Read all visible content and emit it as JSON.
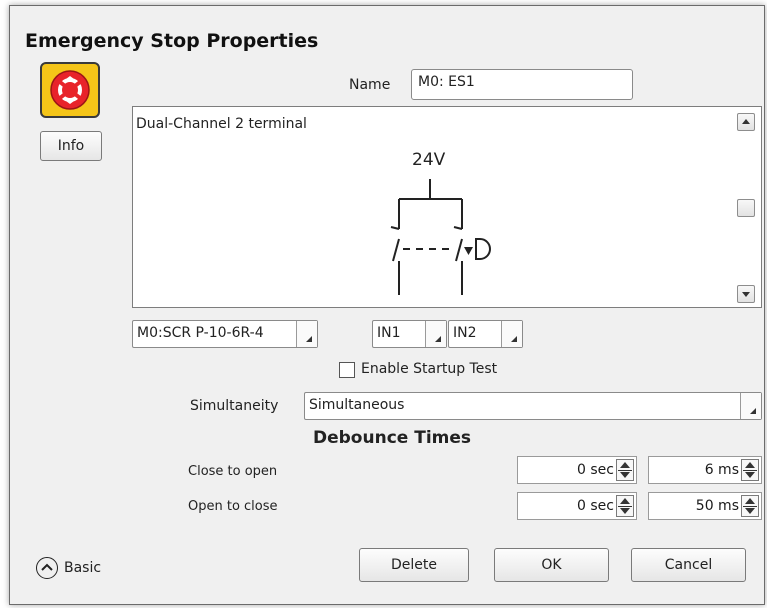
{
  "dialog": {
    "title": "Emergency Stop Properties"
  },
  "info_button": "Info",
  "name_label": "Name",
  "name_value": "M0: ES1",
  "diagram": {
    "caption": "Dual-Channel 2 terminal",
    "voltage": "24V"
  },
  "module_select": "M0:SCR P-10-6R-4",
  "input_a": "IN1",
  "input_b": "IN2",
  "startup_test_label": "Enable Startup Test",
  "startup_test_checked": false,
  "simultaneity_label": "Simultaneity",
  "simultaneity_value": "Simultaneous",
  "debounce": {
    "heading": "Debounce Times",
    "rows": [
      {
        "label": "Close to open",
        "sec": "0 sec",
        "ms": "6 ms"
      },
      {
        "label": "Open to close",
        "sec": "0 sec",
        "ms": "50 ms"
      }
    ]
  },
  "basic_toggle": "Basic",
  "buttons": {
    "delete": "Delete",
    "ok": "OK",
    "cancel": "Cancel"
  },
  "colors": {
    "estop_yellow": "#f5c518",
    "estop_red": "#e8232a"
  }
}
